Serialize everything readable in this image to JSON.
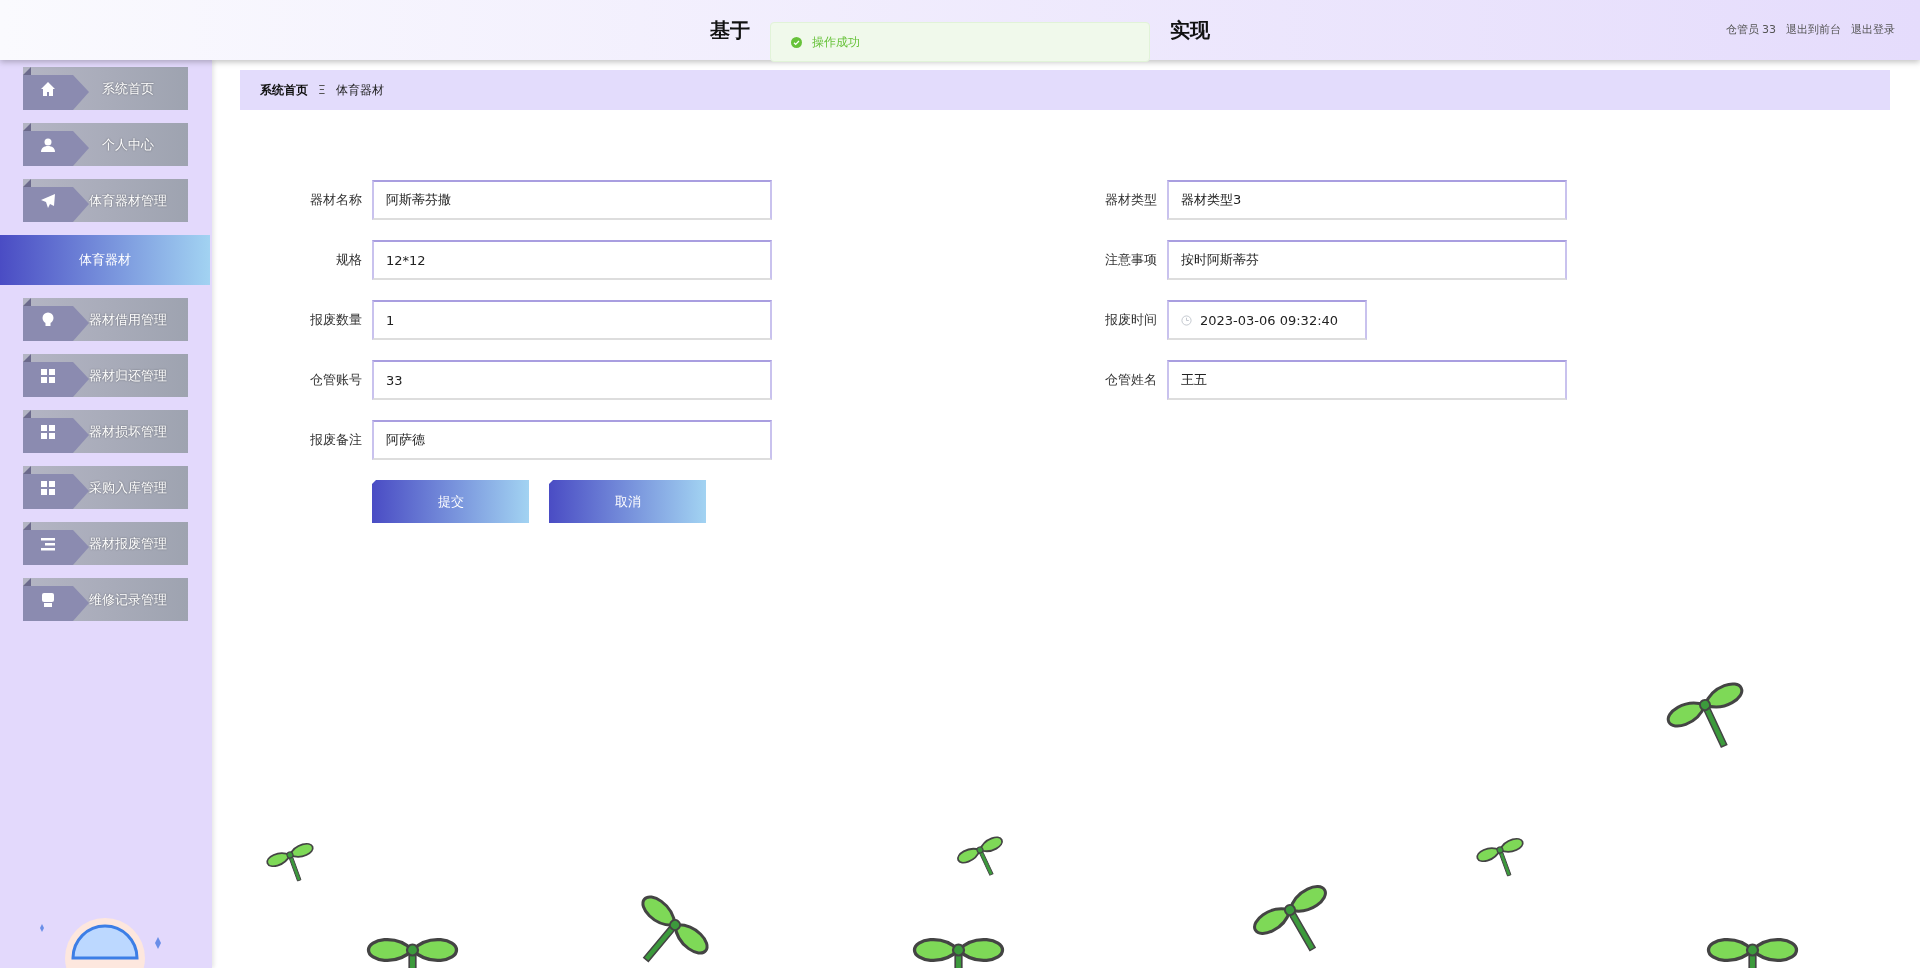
{
  "header": {
    "title_start": "基于",
    "title_end": "实现",
    "user": "仓管员 33",
    "links": [
      "退出到前台",
      "退出登录"
    ]
  },
  "toast": {
    "message": "操作成功"
  },
  "sidebar": {
    "items": [
      {
        "label": "系统首页",
        "kind": "menu",
        "selected": false
      },
      {
        "label": "个人中心",
        "kind": "menu",
        "selected": false
      },
      {
        "label": "体育器材管理",
        "kind": "menu",
        "selected": false
      },
      {
        "label": "体育器材",
        "kind": "submenu",
        "selected": true
      },
      {
        "label": "器材借用管理",
        "kind": "menu",
        "selected": false
      },
      {
        "label": "器材归还管理",
        "kind": "menu",
        "selected": false
      },
      {
        "label": "器材损坏管理",
        "kind": "menu",
        "selected": false
      },
      {
        "label": "采购入库管理",
        "kind": "menu",
        "selected": false
      },
      {
        "label": "器材报废管理",
        "kind": "menu",
        "selected": false
      },
      {
        "label": "维修记录管理",
        "kind": "menu",
        "selected": false
      }
    ]
  },
  "breadcrumb": {
    "items": [
      "系统首页",
      "体育器材"
    ],
    "separator": "Ξ"
  },
  "form": {
    "left": [
      {
        "label": "器材名称",
        "value": "阿斯蒂芬撒",
        "kind": "text"
      },
      {
        "label": "规格",
        "value": "12*12",
        "kind": "text"
      },
      {
        "label": "报废数量",
        "value": "1",
        "kind": "text"
      },
      {
        "label": "仓管账号",
        "value": "33",
        "kind": "text"
      },
      {
        "label": "报废备注",
        "value": "阿萨德",
        "kind": "text"
      }
    ],
    "right": [
      {
        "label": "器材类型",
        "value": "器材类型3",
        "kind": "text"
      },
      {
        "label": "注意事项",
        "value": "按时阿斯蒂芬",
        "kind": "text"
      },
      {
        "label": "报废时间",
        "value": "2023-03-06 09:32:40",
        "kind": "datetime"
      },
      {
        "label": "仓管姓名",
        "value": "王五",
        "kind": "text"
      }
    ],
    "buttons": [
      "提交",
      "取消"
    ]
  }
}
